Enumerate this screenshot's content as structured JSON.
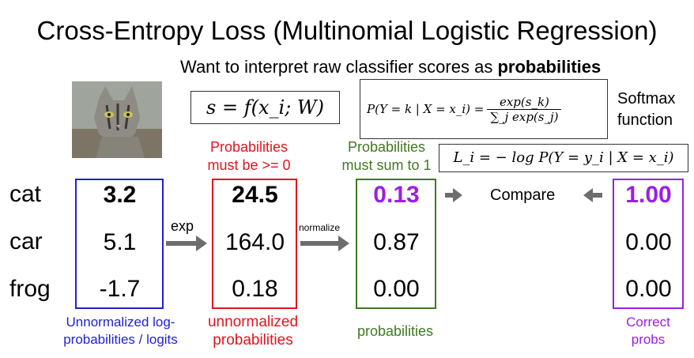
{
  "title": "Cross-Entropy Loss (Multinomial Logistic Regression)",
  "subtitle_prefix": "Want to interpret raw classifier scores as",
  "subtitle_bold": "probabilities",
  "score_eq": "s = f(x_i; W)",
  "softmax_lhs": "P(Y = k | X = x_i) =",
  "softmax_num": "exp(s_k)",
  "softmax_den": "∑_j exp(s_j)",
  "softmax_label_1": "Softmax",
  "softmax_label_2": "function",
  "loss_eq": "L_i = − log P(Y = y_i | X = x_i)",
  "classes": [
    "cat",
    "car",
    "frog"
  ],
  "logits": [
    "3.2",
    "5.1",
    "-1.7"
  ],
  "exp_values": [
    "24.5",
    "164.0",
    "0.18"
  ],
  "probs": [
    "0.13",
    "0.87",
    "0.00"
  ],
  "correct": [
    "1.00",
    "0.00",
    "0.00"
  ],
  "exp_label": "exp",
  "normalize_label": "normalize",
  "compare_label": "Compare",
  "note_nonneg": [
    "Probabilities",
    "must be >= 0"
  ],
  "note_sum": [
    "Probabilities",
    "must sum to 1"
  ],
  "caption_logits": [
    "Unnormalized log-",
    "probabilities / logits"
  ],
  "caption_unnorm": [
    "unnormalized",
    "probabilities"
  ],
  "caption_probs": "probabilities",
  "caption_correct": [
    "Correct",
    "probs"
  ],
  "colors": {
    "blue": "#1f1fd6",
    "red": "#e0141e",
    "green": "#3e7a1e",
    "purple": "#9b1ee6",
    "gray": "#6d6d6d"
  }
}
